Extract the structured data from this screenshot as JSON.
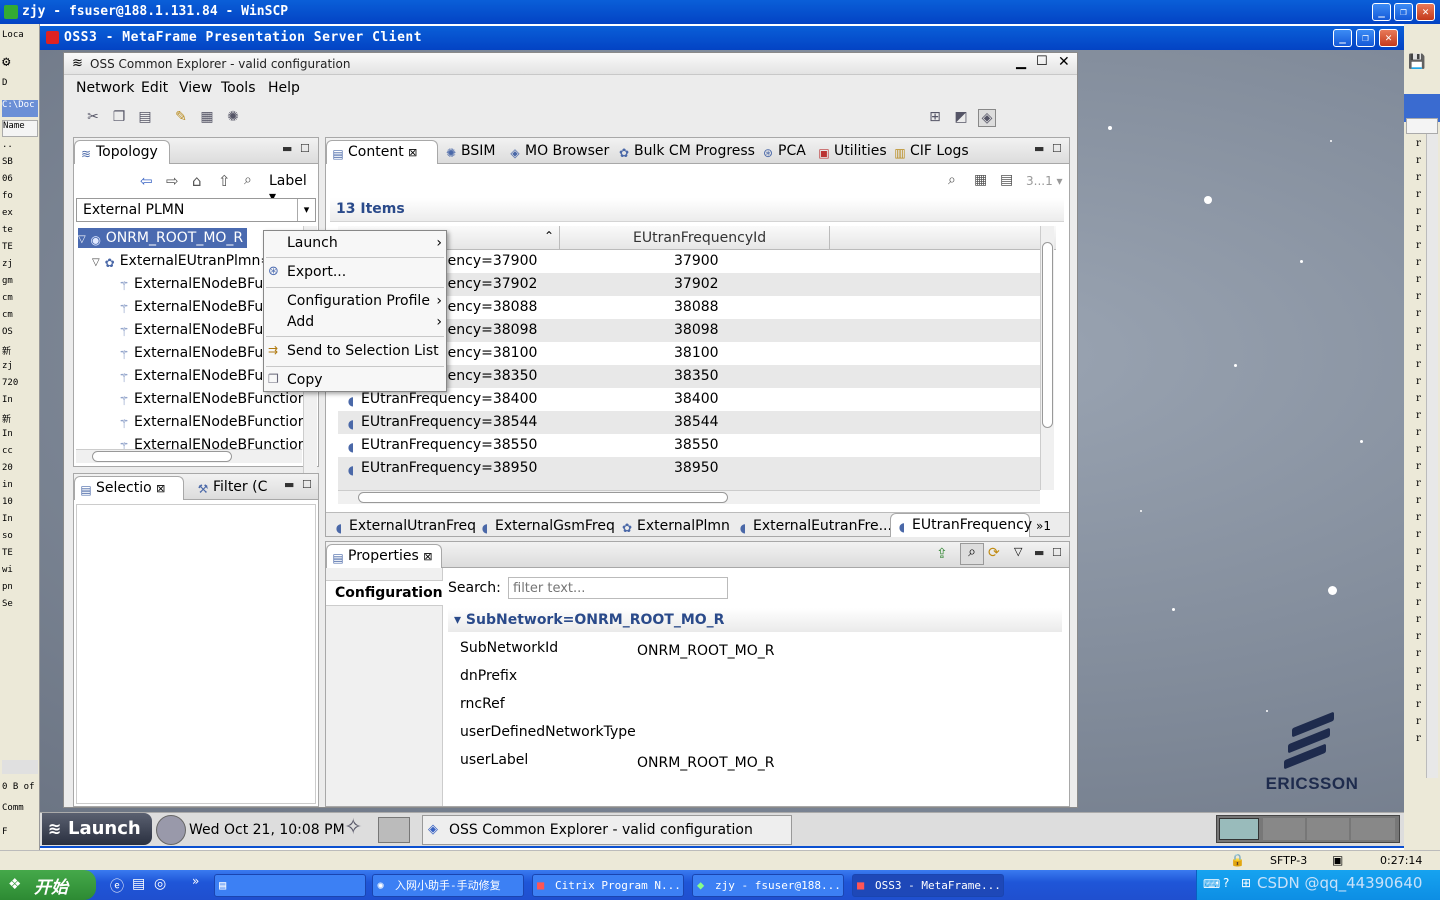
{
  "winscp": {
    "title": "zjy - fsuser@188.1.131.84 - WinSCP",
    "left_labels": [
      "Loca",
      "D",
      "C:\\Doc",
      "Name",
      "..",
      "SB",
      "06",
      "fo",
      "ex",
      "te",
      "TE",
      "zj",
      "gm",
      "cm",
      "cm",
      "OS",
      "新",
      "zj",
      "720",
      "In",
      "新",
      "In",
      "cc",
      "20",
      "in",
      "10",
      "In",
      "so",
      "TE",
      "wi",
      "pn",
      "Se",
      "0 B of",
      "Comm",
      "F"
    ],
    "right_col": "r",
    "status": {
      "sftp": "SFTP-3",
      "time": "0:27:14"
    }
  },
  "citrix": {
    "title": "OSS3 - MetaFrame Presentation Server Client"
  },
  "oss": {
    "title": "OSS Common Explorer - valid configuration",
    "menu": [
      "Network",
      "Edit",
      "View",
      "Tools",
      "Help"
    ],
    "topology": {
      "tab": "Topology",
      "label_combo": "Label",
      "plmn_combo": "External PLMN",
      "tree": [
        "ONRM_ROOT_MO_R",
        "ExternalEUtranPlmn=",
        "ExternalENodeBFu",
        "ExternalENodeBFu",
        "ExternalENodeBFu",
        "ExternalENodeBFu",
        "ExternalENodeBFu",
        "ExternalENodeBFunctior",
        "ExternalENodeBFunctior",
        "ExternalENodeBFunctior"
      ]
    },
    "selection": {
      "tab1": "Selectio",
      "tab2": "Filter (C"
    },
    "content": {
      "tabs": [
        "Content",
        "BSIM",
        "MO Browser",
        "Bulk CM Progress",
        "PCA",
        "Utilities",
        "CIF Logs"
      ],
      "page_indicator": "3...1",
      "items_count": "13 Items",
      "column2": "EUtranFrequencyId",
      "rows": [
        {
          "name": "EUtranFrequency=37900",
          "id": "37900"
        },
        {
          "name": "EUtranFrequency=37902",
          "id": "37902"
        },
        {
          "name": "EUtranFrequency=38088",
          "id": "38088"
        },
        {
          "name": "EUtranFrequency=38098",
          "id": "38098"
        },
        {
          "name": "EUtranFrequency=38100",
          "id": "38100"
        },
        {
          "name": "EUtranFrequency=38350",
          "id": "38350"
        },
        {
          "name": "EUtranFrequency=38400",
          "id": "38400"
        },
        {
          "name": "EUtranFrequency=38544",
          "id": "38544"
        },
        {
          "name": "EUtranFrequency=38550",
          "id": "38550"
        },
        {
          "name": "EUtranFrequency=38950",
          "id": "38950"
        }
      ],
      "bottom_tabs": [
        "ExternalUtranFreq",
        "ExternalGsmFreq",
        "ExternalPlmn",
        "ExternalEutranFre...",
        "EUtranFrequency",
        "»1"
      ]
    },
    "context_menu": {
      "items": [
        "Launch",
        "Export...",
        "Configuration Profile",
        "Add",
        "Send to Selection List",
        "Copy"
      ]
    },
    "properties": {
      "tab": "Properties",
      "side_tab": "Configuration",
      "search_label": "Search:",
      "search_placeholder": "filter text...",
      "section": "SubNetwork=ONRM_ROOT_MO_R",
      "rows": [
        {
          "label": "SubNetworkId",
          "value": "ONRM_ROOT_MO_R"
        },
        {
          "label": "dnPrefix",
          "value": ""
        },
        {
          "label": "rncRef",
          "value": ""
        },
        {
          "label": "userDefinedNetworkType",
          "value": ""
        },
        {
          "label": "userLabel",
          "value": "ONRM_ROOT_MO_R"
        }
      ]
    }
  },
  "citrix_taskbar": {
    "launch": "Launch",
    "datetime": "Wed Oct 21, 10:08 PM",
    "task": "OSS Common Explorer - valid configuration"
  },
  "ericsson": "ERICSSON",
  "xp": {
    "start": "开始",
    "tasks": [
      "入网小助手-手动修复",
      "Citrix Program N...",
      "zjy - fsuser@188...",
      "OSS3 - MetaFrame..."
    ],
    "watermark": "CSDN @qq_44390640"
  },
  "colors": {
    "title_blue": "#0343c4",
    "items_header": "#2a4a8a",
    "tray": "#0d8ee4"
  }
}
